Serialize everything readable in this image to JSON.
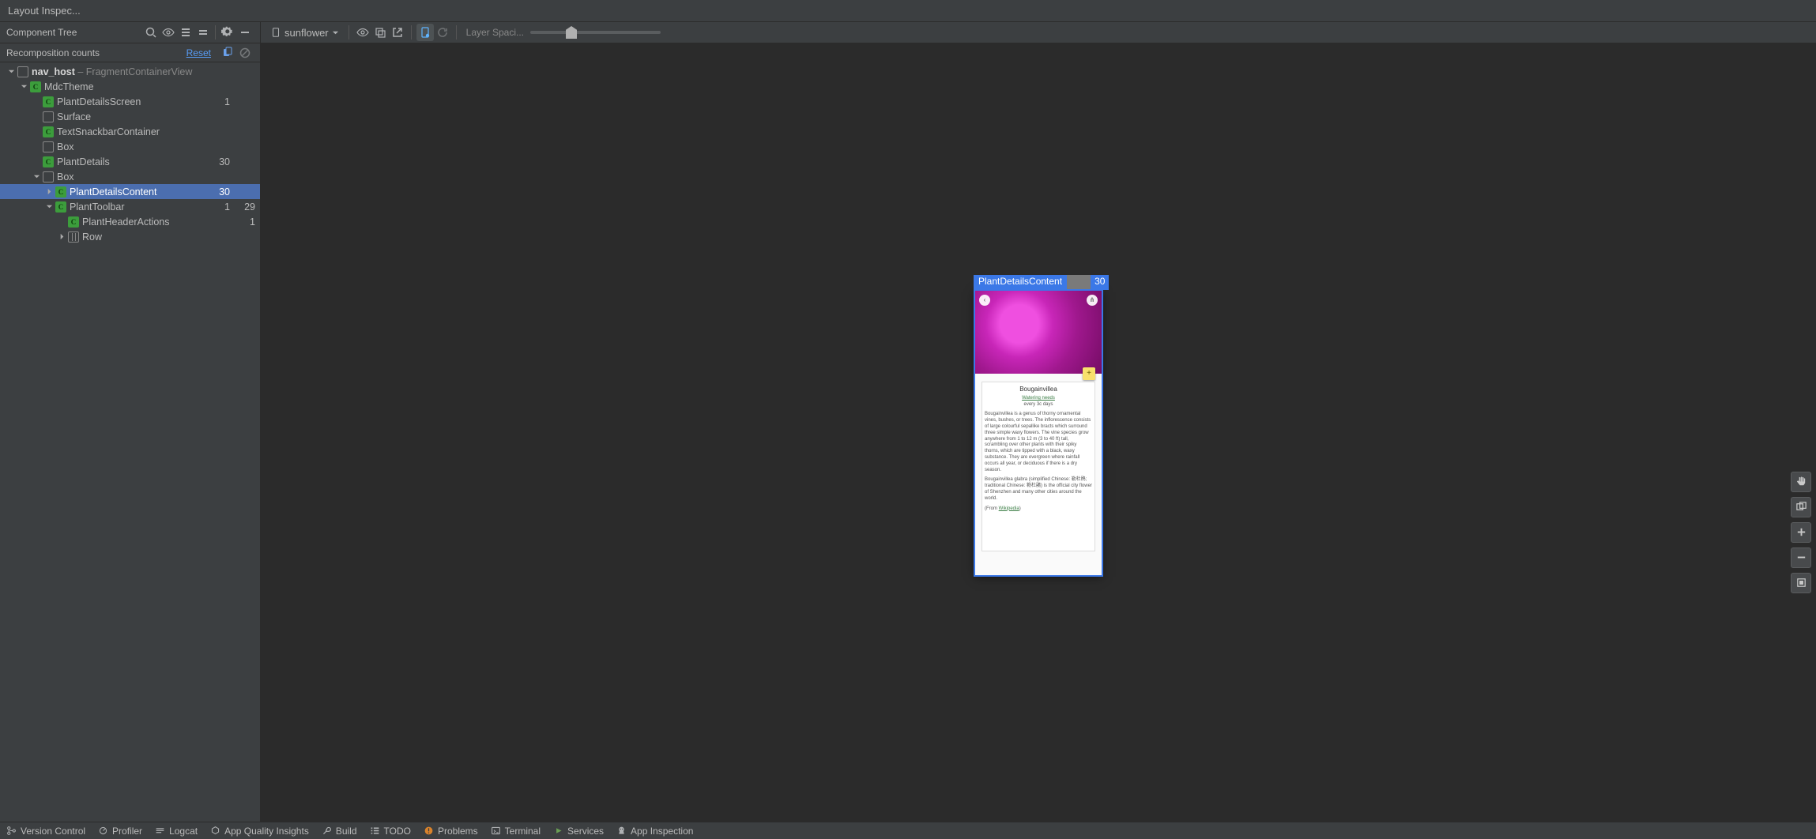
{
  "titlebar": {
    "title": "Layout Inspec..."
  },
  "left": {
    "panel_title": "Component Tree",
    "sub": {
      "label": "Recomposition counts",
      "reset": "Reset"
    },
    "tree": [
      {
        "indent": 0,
        "chev": "down",
        "icon": "layout",
        "name_bold": "nav_host",
        "name_suffix": " – FragmentContainerView",
        "c1": "",
        "c2": ""
      },
      {
        "indent": 1,
        "chev": "down",
        "icon": "compose",
        "name": "MdcTheme",
        "c1": "",
        "c2": ""
      },
      {
        "indent": 2,
        "chev": "",
        "icon": "compose",
        "name": "PlantDetailsScreen",
        "c1": "1",
        "c2": ""
      },
      {
        "indent": 2,
        "chev": "",
        "icon": "layout",
        "name": "Surface",
        "c1": "",
        "c2": ""
      },
      {
        "indent": 2,
        "chev": "",
        "icon": "compose",
        "name": "TextSnackbarContainer",
        "c1": "",
        "c2": ""
      },
      {
        "indent": 2,
        "chev": "",
        "icon": "layout",
        "name": "Box",
        "c1": "",
        "c2": ""
      },
      {
        "indent": 2,
        "chev": "",
        "icon": "compose",
        "name": "PlantDetails",
        "c1": "30",
        "c2": ""
      },
      {
        "indent": 2,
        "chev": "down",
        "icon": "layout",
        "name": "Box",
        "c1": "",
        "c2": ""
      },
      {
        "indent": 3,
        "chev": "right",
        "icon": "compose",
        "name": "PlantDetailsContent",
        "c1": "30",
        "c2": "",
        "selected": true
      },
      {
        "indent": 3,
        "chev": "down",
        "icon": "compose",
        "name": "PlantToolbar",
        "c1": "1",
        "c2": "29"
      },
      {
        "indent": 4,
        "chev": "",
        "icon": "compose",
        "name": "PlantHeaderActions",
        "c1": "",
        "c2": "1"
      },
      {
        "indent": 4,
        "chev": "right",
        "icon": "row",
        "name": "Row",
        "c1": "",
        "c2": ""
      }
    ]
  },
  "right": {
    "process": "sunflower",
    "slider_label": "Layer Spaci...",
    "selection": {
      "name": "PlantDetailsContent",
      "count": "30"
    },
    "preview": {
      "title": "Bougainvillea",
      "watering_label": "Watering needs",
      "watering_value": "every 3c days",
      "para1": "Bougainvillea is a genus of thorny ornamental vines, bushes, or trees. The inflorescence consists of large colourful sepallike bracts which surround three simple waxy flowers. The vine species grow anywhere from 1 to 12 m (3 to 40 ft) tall, scrambling over other plants with their spiky thorns, which are tipped with a black, waxy substance. They are evergreen where rainfall occurs all year, or deciduous if there is a dry season.",
      "para2": "Bougainvillea glabra (simplified Chinese: 勒杜鹃; traditional Chinese: 簕杜鵑) is the official city flower of Shenzhen and many other cities around the world.",
      "from_prefix": "(From ",
      "from_link": "Wikipedia",
      "from_suffix": ")",
      "fab": "+"
    }
  },
  "bottom": {
    "items": [
      "Version Control",
      "Profiler",
      "Logcat",
      "App Quality Insights",
      "Build",
      "TODO",
      "Problems",
      "Terminal",
      "Services",
      "App Inspection"
    ]
  }
}
